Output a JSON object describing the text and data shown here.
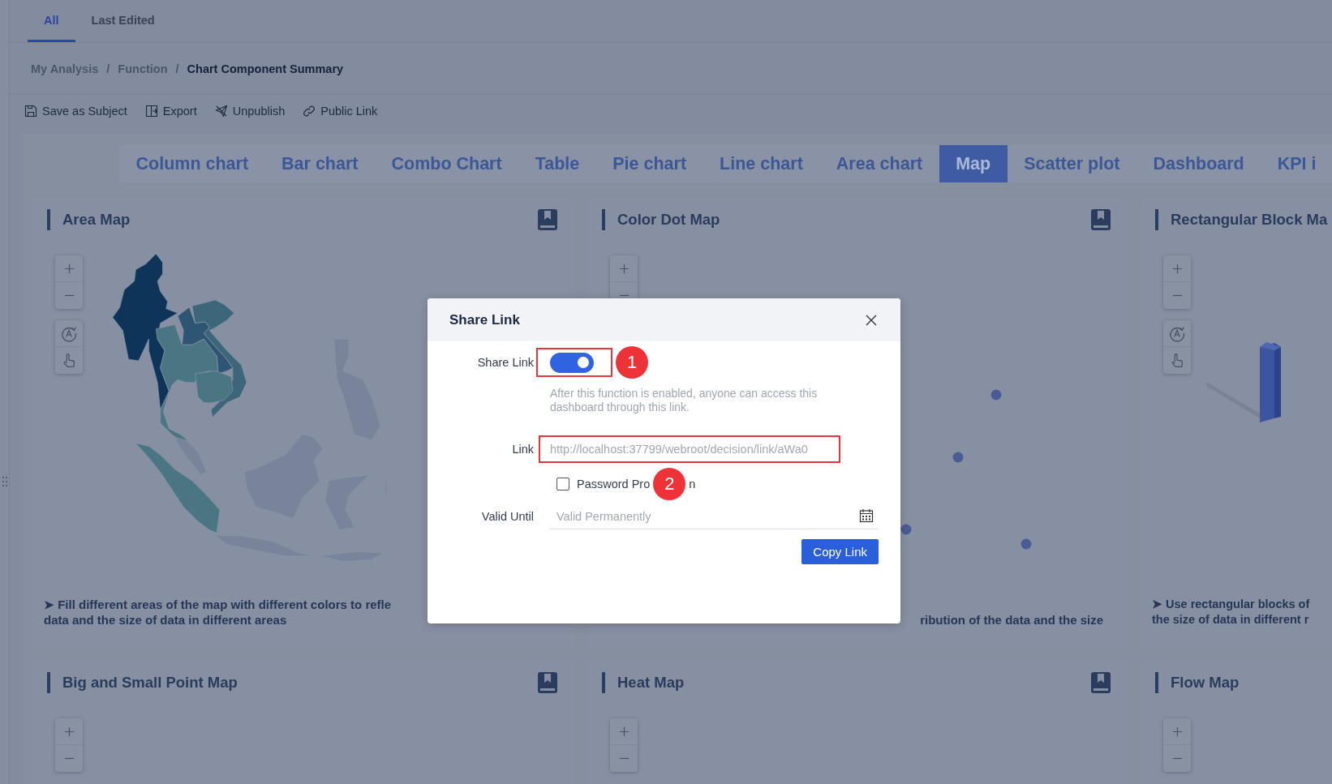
{
  "top_tabs": [
    {
      "label": "All",
      "selected": true
    },
    {
      "label": "Last Edited",
      "selected": false
    }
  ],
  "breadcrumb": {
    "items": [
      {
        "label": "My Analysis",
        "current": false
      },
      {
        "label": "Function",
        "current": false
      },
      {
        "label": "Chart Component Summary",
        "current": true
      }
    ],
    "separators": [
      "/",
      "/"
    ]
  },
  "toolbar": [
    {
      "label": "Save as Subject",
      "kind": "save"
    },
    {
      "label": "Export",
      "kind": "export"
    },
    {
      "label": "Unpublish",
      "kind": "unpublish"
    },
    {
      "label": "Public Link",
      "kind": "link"
    }
  ],
  "chart_tabs": [
    {
      "label": "Column chart",
      "selected": false
    },
    {
      "label": "Bar chart",
      "selected": false
    },
    {
      "label": "Combo Chart",
      "selected": false
    },
    {
      "label": "Table",
      "selected": false
    },
    {
      "label": "Pie chart",
      "selected": false
    },
    {
      "label": "Line chart",
      "selected": false
    },
    {
      "label": "Area chart",
      "selected": false
    },
    {
      "label": "Map",
      "selected": true
    },
    {
      "label": "Scatter plot",
      "selected": false
    },
    {
      "label": "Dashboard",
      "selected": false
    },
    {
      "label": "KPI i",
      "selected": false
    }
  ],
  "cards": [
    {
      "title": "Area Map",
      "guide_icon": true,
      "pan_tools": true,
      "kind": "area_map",
      "description": [
        "➤ Fill different areas of the map with different colors to refle",
        "data and the size of data in different areas"
      ]
    },
    {
      "title": "Color Dot Map",
      "guide_icon": true,
      "pan_tools": false,
      "kind": "dot_map",
      "description": [
        "ribution of the data and the size"
      ]
    },
    {
      "title": "Rectangular Block Ma",
      "guide_icon": false,
      "pan_tools": true,
      "kind": "block_map",
      "description": [
        "➤ Use rectangular blocks of",
        "the size of data in different r"
      ]
    },
    {
      "title": "Big and Small Point Map",
      "guide_icon": true,
      "pan_tools": false
    },
    {
      "title": "Heat Map",
      "guide_icon": true,
      "pan_tools": false
    },
    {
      "title": "Flow Map",
      "guide_icon": false,
      "pan_tools": false
    }
  ],
  "dialog": {
    "title": "Share Link",
    "share_label": "Share Link",
    "share_on": true,
    "hint": "After this function is enabled, anyone can access this dashboard through this link.",
    "link_label": "Link",
    "link_value": "http://localhost:37799/webroot/decision/link/aWa0",
    "password_label": "Password Pro",
    "password_label_tail": "n",
    "password_checked": false,
    "valid_label": "Valid Until",
    "valid_placeholder": "Valid Permanently",
    "copy_button": "Copy Link",
    "callouts": [
      "1",
      "2"
    ]
  }
}
